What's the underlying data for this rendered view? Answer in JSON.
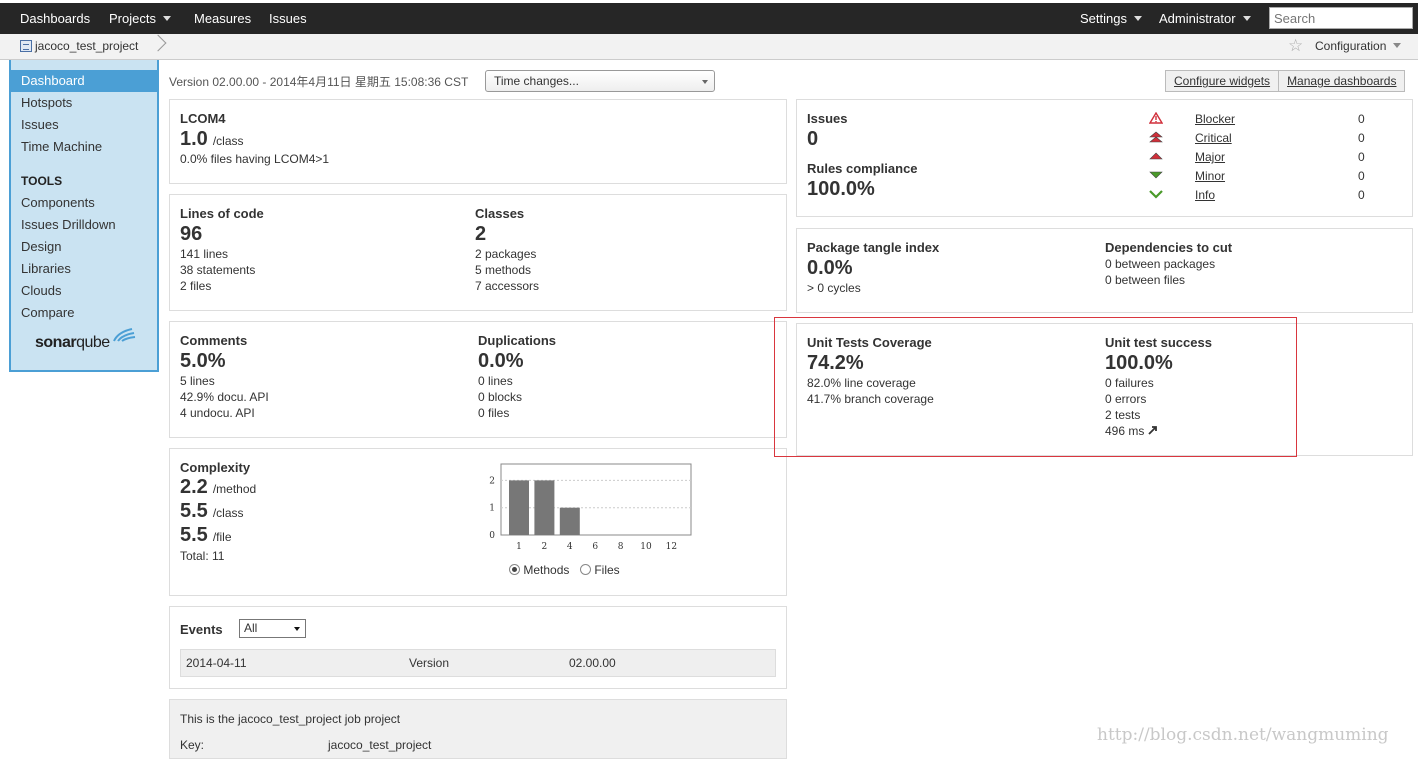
{
  "topnav": {
    "dashboards": "Dashboards",
    "projects": "Projects",
    "measures": "Measures",
    "issues": "Issues",
    "settings": "Settings",
    "administrator": "Administrator",
    "search_placeholder": "Search"
  },
  "breadcrumb": {
    "project": "jacoco_test_project",
    "configuration": "Configuration"
  },
  "sidebar": {
    "items": [
      "Dashboard",
      "Hotspots",
      "Issues",
      "Time Machine"
    ],
    "tools_heading": "TOOLS",
    "tools": [
      "Components",
      "Issues Drilldown",
      "Design",
      "Libraries",
      "Clouds",
      "Compare"
    ],
    "logo_part1": "sonar",
    "logo_part2": "qube"
  },
  "header": {
    "version": "Version 02.00.00 - 2014年4月11日 星期五 15:08:36 CST",
    "time_changes": "Time changes...",
    "configure_widgets": "Configure widgets",
    "manage_dashboards": "Manage dashboards"
  },
  "lcom4": {
    "title": "LCOM4",
    "value": "1.0",
    "unit": "/class",
    "files": "0.0% files having LCOM4>1"
  },
  "size": {
    "loc_title": "Lines of code",
    "loc_value": "96",
    "loc_lines": [
      "141 lines",
      "38 statements",
      "2 files"
    ],
    "classes_title": "Classes",
    "classes_value": "2",
    "classes_lines": [
      "2 packages",
      "5 methods",
      "7 accessors"
    ]
  },
  "comments": {
    "title": "Comments",
    "value": "5.0%",
    "lines": [
      "5 lines",
      "42.9% docu. API",
      "4 undocu. API"
    ],
    "dup_title": "Duplications",
    "dup_value": "0.0%",
    "dup_lines": [
      "0 lines",
      "0 blocks",
      "0 files"
    ]
  },
  "complexity": {
    "title": "Complexity",
    "per_method": "2.2",
    "per_method_unit": "/method",
    "per_class": "5.5",
    "per_class_unit": "/class",
    "per_file": "5.5",
    "per_file_unit": "/file",
    "total": "Total: 11",
    "radio_methods": "Methods",
    "radio_files": "Files"
  },
  "chart_data": {
    "type": "bar",
    "categories": [
      "1",
      "2",
      "4",
      "6",
      "8",
      "10",
      "12"
    ],
    "values": [
      2,
      2,
      1,
      0,
      0,
      0,
      0
    ],
    "ylim": [
      0,
      2.6
    ],
    "yticks": [
      "0",
      "1",
      "2"
    ],
    "bar_color": "#777777"
  },
  "events": {
    "title": "Events",
    "filter": "All",
    "rows": [
      {
        "date": "2014-04-11",
        "category": "Version",
        "name": "02.00.00"
      }
    ]
  },
  "description": {
    "text": "This is the jacoco_test_project job project",
    "key_label": "Key:",
    "key_value": "jacoco_test_project"
  },
  "issues_widget": {
    "title": "Issues",
    "value": "0",
    "compliance_title": "Rules compliance",
    "compliance_value": "100.0%",
    "severities": [
      {
        "name": "Blocker",
        "count": "0",
        "icon": "blocker-icon",
        "color": "#d02f3a"
      },
      {
        "name": "Critical",
        "count": "0",
        "icon": "critical-icon",
        "color": "#d02f3a"
      },
      {
        "name": "Major",
        "count": "0",
        "icon": "major-icon",
        "color": "#d02f3a"
      },
      {
        "name": "Minor",
        "count": "0",
        "icon": "minor-icon",
        "color": "#4a9a2a"
      },
      {
        "name": "Info",
        "count": "0",
        "icon": "info-icon",
        "color": "#4a9a2a"
      }
    ]
  },
  "design": {
    "tangle_title": "Package tangle index",
    "tangle_value": "0.0%",
    "tangle_cycles": "> 0 cycles",
    "deps_title": "Dependencies to cut",
    "deps_lines": [
      "0 between packages",
      "0 between files"
    ]
  },
  "coverage": {
    "title": "Unit Tests Coverage",
    "value": "74.2%",
    "lines": [
      "82.0% line coverage",
      "41.7% branch coverage"
    ],
    "success_title": "Unit test success",
    "success_value": "100.0%",
    "success_lines": [
      "0 failures",
      "0 errors",
      "2 tests",
      "496 ms"
    ]
  },
  "watermark": "http://blog.csdn.net/wangmuming"
}
